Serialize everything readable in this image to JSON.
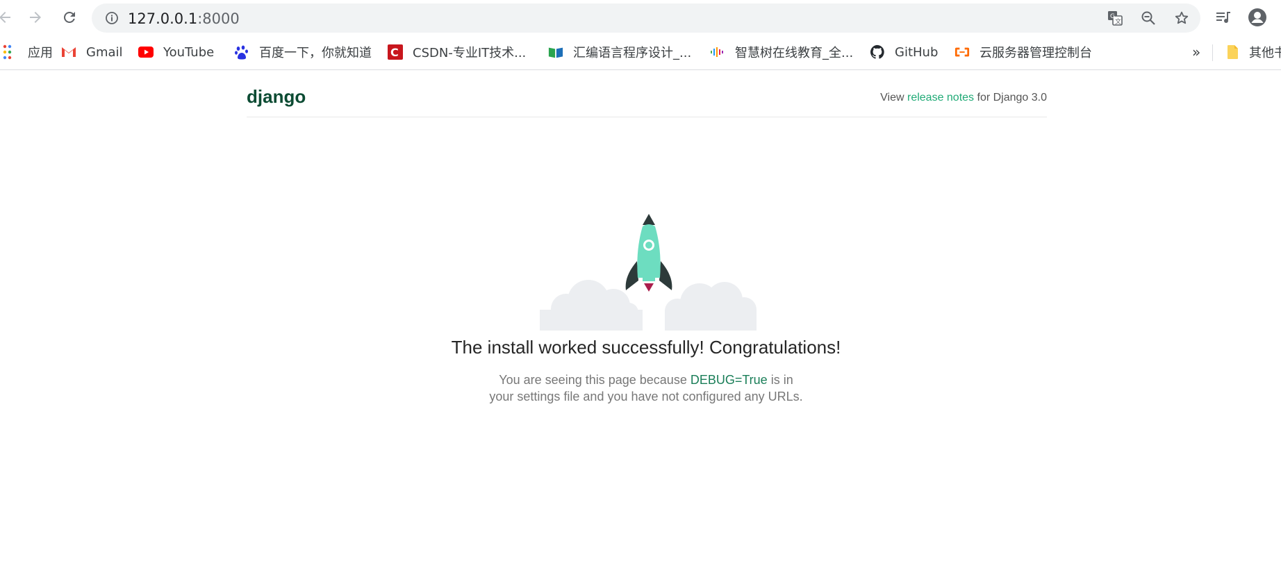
{
  "browser": {
    "url_host": "127.0.0.1",
    "url_port": ":8000",
    "bookmarks": [
      {
        "label": "应用",
        "icon": "apps-grid-icon"
      },
      {
        "label": "Gmail",
        "icon": "gmail-icon"
      },
      {
        "label": "YouTube",
        "icon": "youtube-icon"
      },
      {
        "label": "百度一下，你就知道",
        "icon": "baidu-paw-icon"
      },
      {
        "label": "CSDN-专业IT技术...",
        "icon": "csdn-icon"
      },
      {
        "label": "汇编语言程序设计_...",
        "icon": "book-icon"
      },
      {
        "label": "智慧树在线教育_全...",
        "icon": "zhihuishu-icon"
      },
      {
        "label": "GitHub",
        "icon": "github-icon"
      },
      {
        "label": "云服务器管理控制台",
        "icon": "aliyun-icon"
      }
    ],
    "overflow_label": "»",
    "other_bookmarks_label": "其他书"
  },
  "page": {
    "logo": "django",
    "release_prefix": "View ",
    "release_link": "release notes",
    "release_suffix": " for Django 3.0",
    "headline": "The install worked successfully! Congratulations!",
    "sub_prefix": "You are seeing this page because ",
    "sub_debug": "DEBUG=True",
    "sub_suffix": " is in your settings file and you have not configured any URLs."
  },
  "colors": {
    "logo": "#0c4b33",
    "link": "#20aa76",
    "rocket_body": "#6dddc0",
    "rocket_dark": "#2d3a3a",
    "rocket_flame": "#aa1e4c",
    "cloud": "#eceef1"
  }
}
